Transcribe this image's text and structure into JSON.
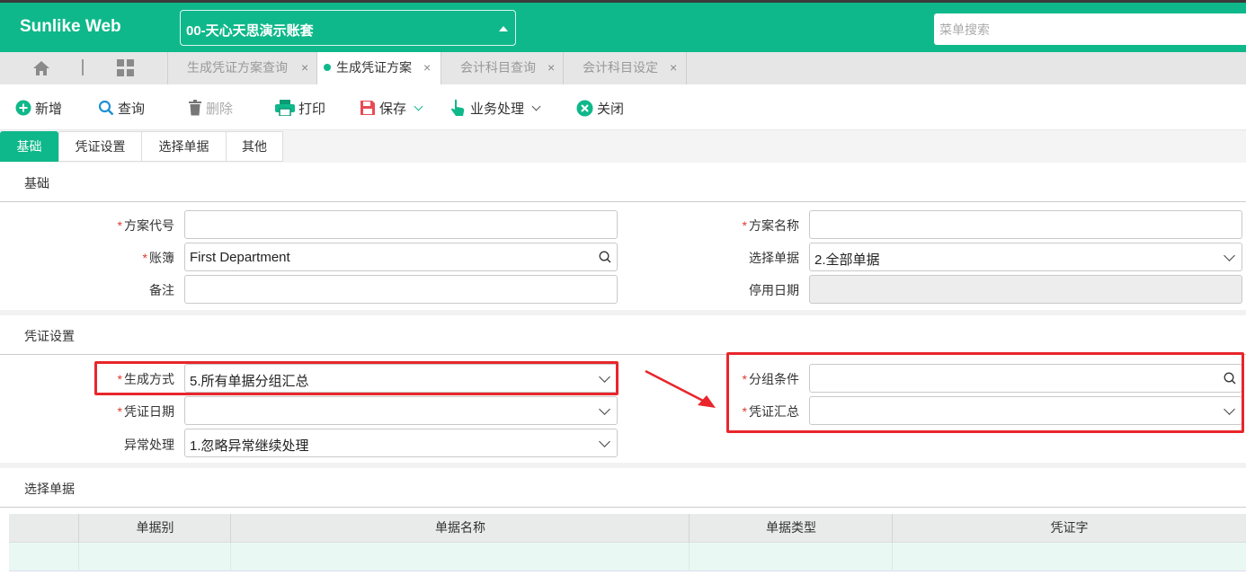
{
  "app": {
    "brand": "Sunlike Web",
    "account": "00-天心天思演示账套",
    "search_placeholder": "菜单搜索",
    "accent_color": "#0fb88a"
  },
  "tabs": [
    {
      "label": "生成凭证方案查询",
      "active": false
    },
    {
      "label": "生成凭证方案",
      "active": true
    },
    {
      "label": "会计科目查询",
      "active": false
    },
    {
      "label": "会计科目设定",
      "active": false
    }
  ],
  "toolbar": {
    "add": "新增",
    "query": "查询",
    "delete": "删除",
    "print": "打印",
    "save": "保存",
    "business": "业务处理",
    "close": "关闭"
  },
  "section_tabs": [
    "基础",
    "凭证设置",
    "选择单据",
    "其他"
  ],
  "basic": {
    "title": "基础",
    "scheme_code_label": "方案代号",
    "scheme_code_value": "",
    "scheme_name_label": "方案名称",
    "scheme_name_value": "",
    "ledger_label": "账簿",
    "ledger_value": "First Department",
    "select_doc_label": "选择单据",
    "select_doc_value": "2.全部单据",
    "remark_label": "备注",
    "remark_value": "",
    "disable_date_label": "停用日期",
    "disable_date_value": ""
  },
  "voucher": {
    "title": "凭证设置",
    "gen_method_label": "生成方式",
    "gen_method_value": "5.所有单据分组汇总",
    "group_cond_label": "分组条件",
    "group_cond_value": "",
    "voucher_date_label": "凭证日期",
    "voucher_date_value": "",
    "voucher_summary_label": "凭证汇总",
    "voucher_summary_value": "",
    "exception_label": "异常处理",
    "exception_value": "1.忽略异常继续处理"
  },
  "select_docs": {
    "title": "选择单据",
    "columns": [
      "单据别",
      "单据名称",
      "单据类型",
      "凭证字"
    ]
  }
}
